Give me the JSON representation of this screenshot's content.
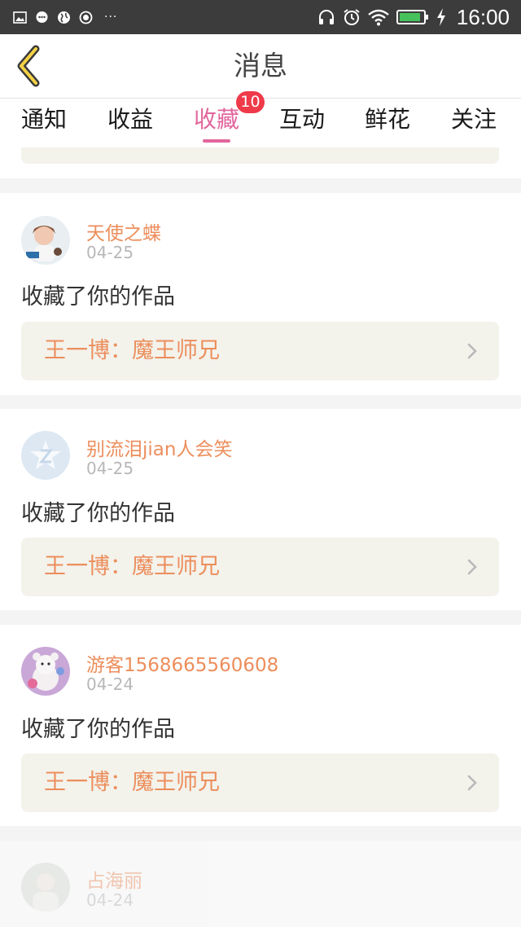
{
  "status_bar": {
    "time": "16:00",
    "dots": "···",
    "icons": [
      "image-icon",
      "chat-icon",
      "globe-icon",
      "record-icon",
      "headphones-icon",
      "alarm-icon",
      "wifi-icon",
      "battery-icon",
      "charging-icon"
    ]
  },
  "header": {
    "title": "消息",
    "back_icon": "back-chevron-icon"
  },
  "tabs": [
    {
      "label": "通知",
      "active": false
    },
    {
      "label": "收益",
      "active": false
    },
    {
      "label": "收藏",
      "active": true,
      "badge": "10"
    },
    {
      "label": "互动",
      "active": false
    },
    {
      "label": "鲜花",
      "active": false
    },
    {
      "label": "关注",
      "active": false
    }
  ],
  "messages": [
    {
      "user": "天使之蝶",
      "date": "04-25",
      "text": "收藏了你的作品",
      "work": "王一博：魔王师兄"
    },
    {
      "user": "别流泪jian人会笑",
      "date": "04-25",
      "text": "收藏了你的作品",
      "work": "王一博：魔王师兄"
    },
    {
      "user": "游客1568665560608",
      "date": "04-24",
      "text": "收藏了你的作品",
      "work": "王一博：魔王师兄"
    },
    {
      "user": "占海丽",
      "date": "04-24"
    }
  ],
  "colors": {
    "accent_pink": "#e2669c",
    "name_orange": "#ec8e5c",
    "badge_red": "#ef3a4a",
    "card_box": "#f3f2eb"
  }
}
